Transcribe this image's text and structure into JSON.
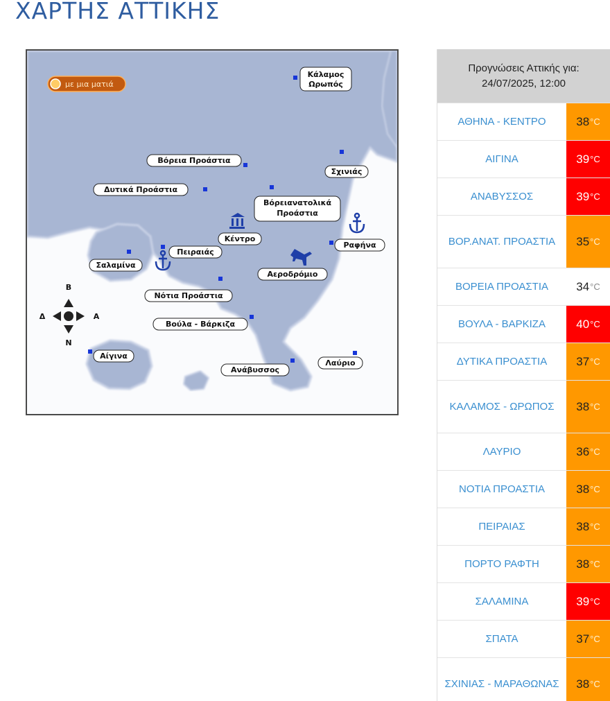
{
  "page_title": "ΧΑΡΤΗΣ ΑΤΤΙΚΗΣ",
  "map": {
    "quick_look_button": "με μια ματιά",
    "labels": {
      "kalamos": "Κάλαμος",
      "oropos": "Ωρωπός",
      "voreia": "Βόρεια Προάστια",
      "schinias": "Σχινιάς",
      "dytika": "Δυτικά Προάστια",
      "voreioanat_1": "Βόρειανατολικά",
      "voreioanat_2": "Προάστια",
      "kentro": "Κέντρο",
      "rafina": "Ραφήνα",
      "peiraias": "Πειραιάς",
      "salamina": "Σαλαμίνα",
      "aerodromio": "Αεροδρόμιο",
      "notia": "Νότια Προάστια",
      "voula": "Βούλα - Βάρκιζα",
      "aigina": "Αίγινα",
      "lavrio": "Λαύριο",
      "anavyssos": "Ανάβυσσος"
    },
    "compass": {
      "north": "B",
      "south": "N",
      "west": "Δ",
      "east": "A"
    }
  },
  "forecast": {
    "heading_line1": "Προγνώσεις Αττικής για:",
    "heading_line2": "24/07/2025, 12:00",
    "unit": "°C",
    "rows": [
      {
        "name": "ΑΘΗΝΑ - ΚΕΝΤΡΟ",
        "temp": "38",
        "level": "orange"
      },
      {
        "name": "ΑΙΓΙΝΑ",
        "temp": "39",
        "level": "red"
      },
      {
        "name": "ΑΝΑΒΥΣΣΟΣ",
        "temp": "39",
        "level": "red"
      },
      {
        "name": "ΒΟΡ.ΑΝΑΤ. ΠΡΟΑΣΤΙΑ",
        "temp": "35",
        "level": "orange"
      },
      {
        "name": "ΒΟΡΕΙΑ ΠΡΟΑΣΤΙΑ",
        "temp": "34",
        "level": "white"
      },
      {
        "name": "ΒΟΥΛΑ - ΒΑΡΚΙΖΑ",
        "temp": "40",
        "level": "red"
      },
      {
        "name": "ΔΥΤΙΚΑ ΠΡΟΑΣΤΙΑ",
        "temp": "37",
        "level": "orange"
      },
      {
        "name": "ΚΑΛΑΜΟΣ - ΩΡΩΠΟΣ",
        "temp": "38",
        "level": "orange"
      },
      {
        "name": "ΛΑΥΡΙΟ",
        "temp": "36",
        "level": "orange"
      },
      {
        "name": "ΝΟΤΙΑ ΠΡΟΑΣΤΙΑ",
        "temp": "38",
        "level": "orange"
      },
      {
        "name": "ΠΕΙΡΑΙΑΣ",
        "temp": "38",
        "level": "orange"
      },
      {
        "name": "ΠΟΡΤΟ ΡΑΦΤΗ",
        "temp": "38",
        "level": "orange"
      },
      {
        "name": "ΣΑΛΑΜΙΝΑ",
        "temp": "39",
        "level": "red"
      },
      {
        "name": "ΣΠΑΤΑ",
        "temp": "37",
        "level": "orange"
      },
      {
        "name": "ΣΧΙΝΙΑΣ - ΜΑΡΑΘΩΝΑΣ",
        "temp": "38",
        "level": "orange"
      }
    ]
  }
}
